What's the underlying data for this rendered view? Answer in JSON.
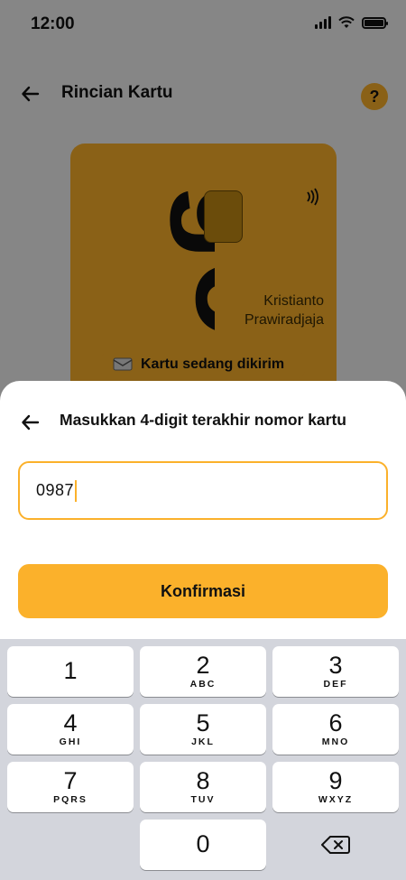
{
  "status": {
    "time": "12:00"
  },
  "header": {
    "title": "Rincian Kartu",
    "help_label": "?"
  },
  "card": {
    "brand": "go",
    "holder_line1": "Kristianto",
    "holder_line2": "Prawiradjaja",
    "shipping_status": "Kartu sedang dikirim"
  },
  "sheet": {
    "title": "Masukkan 4-digit terakhir nomor kartu",
    "input_value": "0987",
    "confirm_label": "Konfirmasi"
  },
  "keypad": {
    "keys": [
      {
        "num": "1",
        "letters": ""
      },
      {
        "num": "2",
        "letters": "ABC"
      },
      {
        "num": "3",
        "letters": "DEF"
      },
      {
        "num": "4",
        "letters": "GHI"
      },
      {
        "num": "5",
        "letters": "JKL"
      },
      {
        "num": "6",
        "letters": "MNO"
      },
      {
        "num": "7",
        "letters": "PQRS"
      },
      {
        "num": "8",
        "letters": "TUV"
      },
      {
        "num": "9",
        "letters": "WXYZ"
      },
      {
        "num": "0",
        "letters": ""
      }
    ]
  },
  "colors": {
    "accent": "#fbb12b",
    "keypad_bg": "#d3d5dc"
  }
}
